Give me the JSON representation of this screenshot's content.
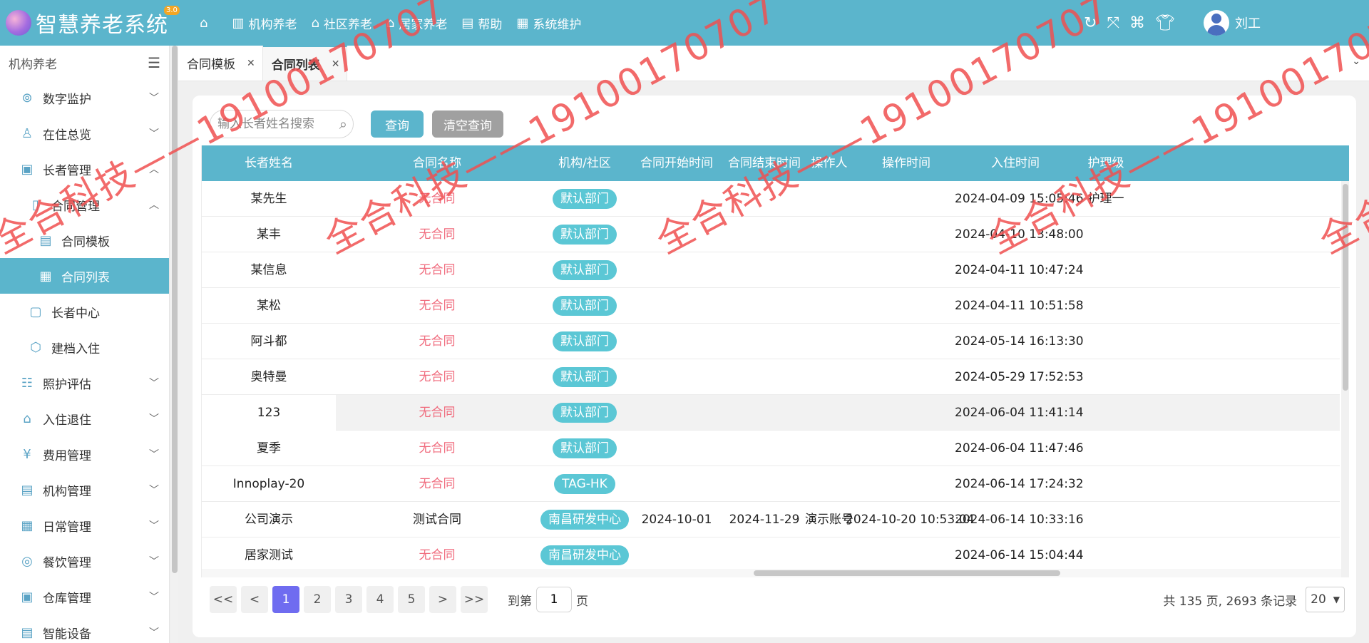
{
  "app": {
    "title": "智慧养老系统",
    "version": "3.0"
  },
  "topnav": [
    {
      "icon": "home-icon",
      "glyph": "⌂",
      "label": ""
    },
    {
      "icon": "building-icon",
      "glyph": "▥",
      "label": "机构养老"
    },
    {
      "icon": "community-icon",
      "glyph": "⌂",
      "label": "社区养老"
    },
    {
      "icon": "house-icon",
      "glyph": "⌂",
      "label": "居家养老"
    },
    {
      "icon": "help-icon",
      "glyph": "▤",
      "label": "帮助"
    },
    {
      "icon": "grid-icon",
      "glyph": "▦",
      "label": "系统维护"
    }
  ],
  "toolbar": {
    "user_name": "刘工"
  },
  "sidebar": {
    "header": "机构养老",
    "items": [
      {
        "label": "数字监护",
        "icon": "monitor-icon",
        "arrow": "down"
      },
      {
        "label": "在住总览",
        "icon": "person-icon",
        "arrow": "down"
      },
      {
        "label": "长者管理",
        "icon": "id-card-icon",
        "arrow": "up"
      },
      {
        "label": "合同管理",
        "icon": "book-icon",
        "arrow": "up"
      },
      {
        "label": "合同模板",
        "icon": "document-icon"
      },
      {
        "label": "合同列表",
        "icon": "list-icon"
      },
      {
        "label": "长者中心",
        "icon": "user-square-icon"
      },
      {
        "label": "建档入住",
        "icon": "box-icon"
      },
      {
        "label": "照护评估",
        "icon": "checklist-icon",
        "arrow": "down"
      },
      {
        "label": "入住退住",
        "icon": "door-icon",
        "arrow": "down"
      },
      {
        "label": "费用管理",
        "icon": "yen-icon",
        "arrow": "down"
      },
      {
        "label": "机构管理",
        "icon": "building-list-icon",
        "arrow": "down"
      },
      {
        "label": "日常管理",
        "icon": "calendar-icon",
        "arrow": "down"
      },
      {
        "label": "餐饮管理",
        "icon": "dining-icon",
        "arrow": "down"
      },
      {
        "label": "仓库管理",
        "icon": "warehouse-icon",
        "arrow": "down"
      },
      {
        "label": "智能设备",
        "icon": "device-icon",
        "arrow": "down"
      }
    ]
  },
  "tabs": [
    {
      "label": "合同模板"
    },
    {
      "label": "合同列表"
    }
  ],
  "search": {
    "placeholder": "输入长者姓名搜索",
    "query_label": "查询",
    "clear_label": "清空查询"
  },
  "table": {
    "columns": [
      "长者姓名",
      "合同名称",
      "机构/社区",
      "合同开始时间",
      "合同结束时间",
      "操作人",
      "操作时间",
      "入住时间",
      "护理级"
    ],
    "rows": [
      {
        "name": "某先生",
        "contract": "无合同",
        "org": "默认部门",
        "start": "",
        "end": "",
        "operator": "",
        "op_time": "",
        "checkin": "2024-04-09 15:05:46",
        "care": "护理一"
      },
      {
        "name": "某丰",
        "contract": "无合同",
        "org": "默认部门",
        "start": "",
        "end": "",
        "operator": "",
        "op_time": "",
        "checkin": "2024-04-10 13:48:00",
        "care": ""
      },
      {
        "name": "某信息",
        "contract": "无合同",
        "org": "默认部门",
        "start": "",
        "end": "",
        "operator": "",
        "op_time": "",
        "checkin": "2024-04-11 10:47:24",
        "care": ""
      },
      {
        "name": "某松",
        "contract": "无合同",
        "org": "默认部门",
        "start": "",
        "end": "",
        "operator": "",
        "op_time": "",
        "checkin": "2024-04-11 10:51:58",
        "care": ""
      },
      {
        "name": "阿斗都",
        "contract": "无合同",
        "org": "默认部门",
        "start": "",
        "end": "",
        "operator": "",
        "op_time": "",
        "checkin": "2024-05-14 16:13:30",
        "care": ""
      },
      {
        "name": "奥特曼",
        "contract": "无合同",
        "org": "默认部门",
        "start": "",
        "end": "",
        "operator": "",
        "op_time": "",
        "checkin": "2024-05-29 17:52:53",
        "care": ""
      },
      {
        "name": "123",
        "contract": "无合同",
        "org": "默认部门",
        "start": "",
        "end": "",
        "operator": "",
        "op_time": "",
        "checkin": "2024-06-04 11:41:14",
        "care": ""
      },
      {
        "name": "夏季",
        "contract": "无合同",
        "org": "默认部门",
        "start": "",
        "end": "",
        "operator": "",
        "op_time": "",
        "checkin": "2024-06-04 11:47:46",
        "care": ""
      },
      {
        "name": "Innoplay-20",
        "contract": "无合同",
        "org": "TAG-HK",
        "start": "",
        "end": "",
        "operator": "",
        "op_time": "",
        "checkin": "2024-06-14 17:24:32",
        "care": ""
      },
      {
        "name": "公司演示",
        "contract": "测试合同",
        "org": "南昌研发中心",
        "start": "2024-10-01",
        "end": "2024-11-29",
        "operator": "演示账号",
        "op_time": "2024-10-20 10:53:04",
        "checkin": "2024-06-14 10:33:16",
        "care": ""
      },
      {
        "name": "居家测试",
        "contract": "无合同",
        "org": "南昌研发中心",
        "start": "",
        "end": "",
        "operator": "",
        "op_time": "",
        "checkin": "2024-06-14 15:04:44",
        "care": ""
      }
    ]
  },
  "pagination": {
    "first": "<<",
    "prev": "<",
    "pages": [
      "1",
      "2",
      "3",
      "4",
      "5"
    ],
    "current": "1",
    "next": ">",
    "last": ">>",
    "goto_prefix": "到第",
    "goto_value": "1",
    "goto_suffix": "页",
    "summary": "共 135 页, 2693 条记录",
    "page_size": "20"
  },
  "watermark": {
    "text": "全合科技——19100170707"
  },
  "colors": {
    "primary": "#5bb5cc",
    "no_contract": "#f06b7d",
    "pill": "#5bc7d5",
    "active_page": "#6f6cf0",
    "watermark": "#f05050"
  }
}
